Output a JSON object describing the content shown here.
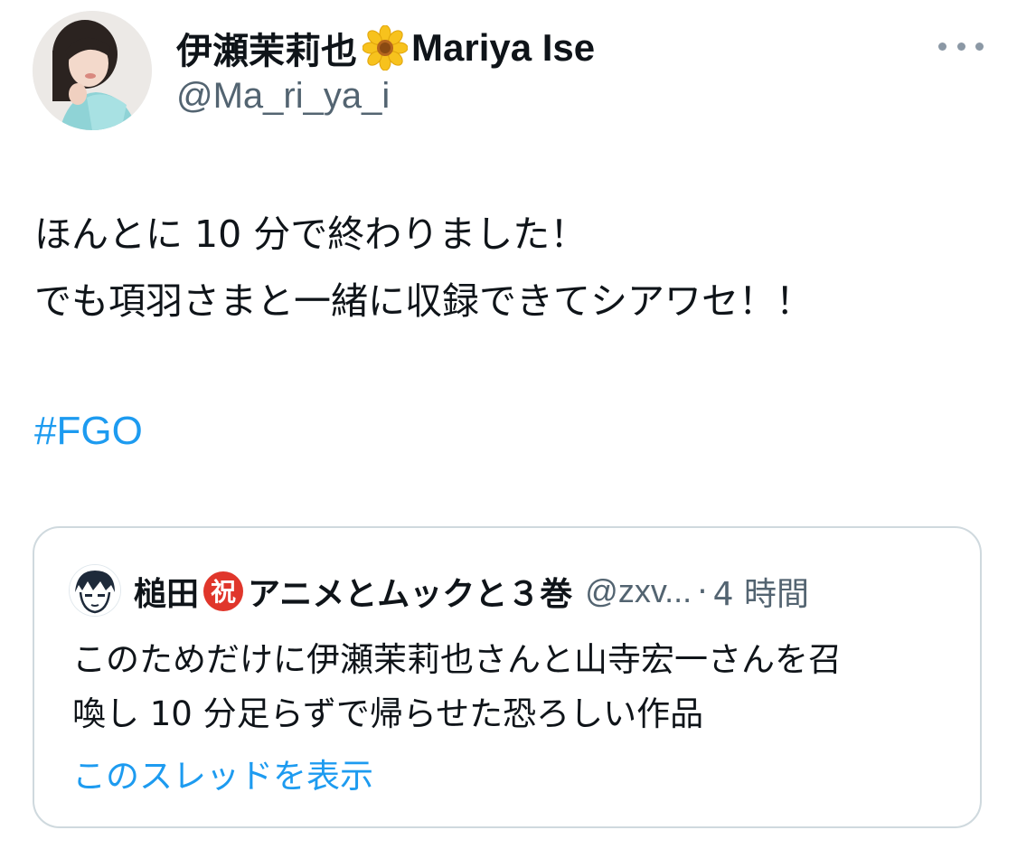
{
  "tweet": {
    "author": {
      "display_name_ja": "伊瀬茉莉也",
      "name_emoji": "sunflower-icon",
      "display_name_en": "Mariya Ise",
      "handle": "@Ma_ri_ya_i"
    },
    "text_lines": [
      "ほんとに 10 分で終わりました！",
      "でも項羽さまと一緒に収録できてシアワセ！！"
    ],
    "hashtag": "#FGO",
    "more_icon": "more-options-icon"
  },
  "quoted_tweet": {
    "name_part1": "槌田",
    "name_emoji": "congratulation-kanji-icon",
    "name_part2": "アニメとムックと３巻",
    "handle": "@zxv...",
    "separator": "·",
    "time": "4 時間",
    "text_lines": [
      "このためだけに伊瀬茉莉也さんと山寺宏一さんを召",
      "喚し 10 分足らずで帰らせた恐ろしい作品"
    ],
    "show_thread": "このスレッドを表示"
  },
  "colors": {
    "text": "#0f1419",
    "secondary": "#536471",
    "link": "#1d9bf0",
    "border": "#cfd9de"
  }
}
